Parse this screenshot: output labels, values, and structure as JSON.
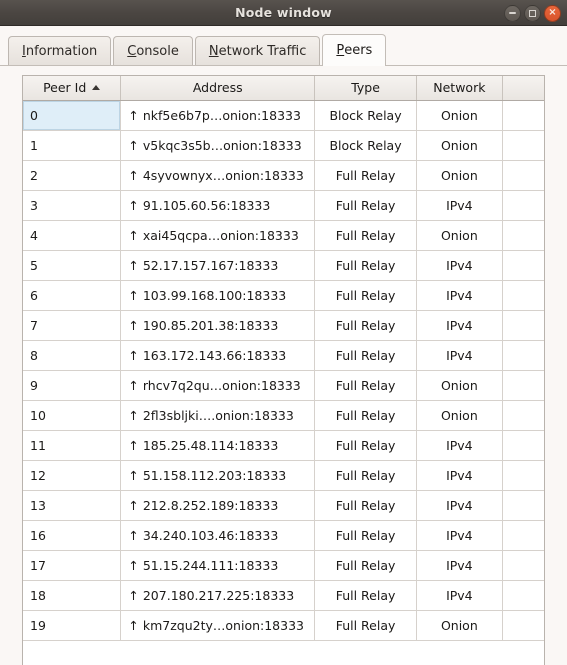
{
  "window": {
    "title": "Node window",
    "controls": [
      {
        "name": "minimize",
        "label": "–"
      },
      {
        "name": "maximize",
        "label": "□"
      },
      {
        "name": "close",
        "label": "×"
      }
    ]
  },
  "tabs": [
    {
      "label": "Information",
      "mnemonic": "I",
      "rest": "nformation",
      "active": false
    },
    {
      "label": "Console",
      "mnemonic": "C",
      "rest": "onsole",
      "active": false
    },
    {
      "label": "Network Traffic",
      "mnemonic": "N",
      "rest": "etwork Traffic",
      "active": false
    },
    {
      "label": "Peers",
      "mnemonic": "P",
      "rest": "eers",
      "active": true
    }
  ],
  "table": {
    "sort_column": "Peer Id",
    "sort_direction": "ascending",
    "columns": [
      "Peer Id",
      "Address",
      "Type",
      "Network",
      ""
    ],
    "selected_row_index": 0,
    "rows": [
      {
        "id": "0",
        "arrow": "↑",
        "address": "nkf5e6b7p…onion:18333",
        "type": "Block Relay",
        "network": "Onion"
      },
      {
        "id": "1",
        "arrow": "↑",
        "address": "v5kqc3s5b…onion:18333",
        "type": "Block Relay",
        "network": "Onion"
      },
      {
        "id": "2",
        "arrow": "↑",
        "address": "4syvownyx…onion:18333",
        "type": "Full Relay",
        "network": "Onion"
      },
      {
        "id": "3",
        "arrow": "↑",
        "address": "91.105.60.56:18333",
        "type": "Full Relay",
        "network": "IPv4"
      },
      {
        "id": "4",
        "arrow": "↑",
        "address": "xai45qcpa…onion:18333",
        "type": "Full Relay",
        "network": "Onion"
      },
      {
        "id": "5",
        "arrow": "↑",
        "address": "52.17.157.167:18333",
        "type": "Full Relay",
        "network": "IPv4"
      },
      {
        "id": "6",
        "arrow": "↑",
        "address": "103.99.168.100:18333",
        "type": "Full Relay",
        "network": "IPv4"
      },
      {
        "id": "7",
        "arrow": "↑",
        "address": "190.85.201.38:18333",
        "type": "Full Relay",
        "network": "IPv4"
      },
      {
        "id": "8",
        "arrow": "↑",
        "address": "163.172.143.66:18333",
        "type": "Full Relay",
        "network": "IPv4"
      },
      {
        "id": "9",
        "arrow": "↑",
        "address": "rhcv7q2qu…onion:18333",
        "type": "Full Relay",
        "network": "Onion"
      },
      {
        "id": "10",
        "arrow": "↑",
        "address": "2fl3sbljki….onion:18333",
        "type": "Full Relay",
        "network": "Onion"
      },
      {
        "id": "11",
        "arrow": "↑",
        "address": "185.25.48.114:18333",
        "type": "Full Relay",
        "network": "IPv4"
      },
      {
        "id": "12",
        "arrow": "↑",
        "address": "51.158.112.203:18333",
        "type": "Full Relay",
        "network": "IPv4"
      },
      {
        "id": "13",
        "arrow": "↑",
        "address": "212.8.252.189:18333",
        "type": "Full Relay",
        "network": "IPv4"
      },
      {
        "id": "16",
        "arrow": "↑",
        "address": "34.240.103.46:18333",
        "type": "Full Relay",
        "network": "IPv4"
      },
      {
        "id": "17",
        "arrow": "↑",
        "address": "51.15.244.111:18333",
        "type": "Full Relay",
        "network": "IPv4"
      },
      {
        "id": "18",
        "arrow": "↑",
        "address": "207.180.217.225:18333",
        "type": "Full Relay",
        "network": "IPv4"
      },
      {
        "id": "19",
        "arrow": "↑",
        "address": "km7zqu2ty…onion:18333",
        "type": "Full Relay",
        "network": "Onion"
      }
    ]
  },
  "colors": {
    "titlebar": "#4b4642",
    "close_button": "#d9542c",
    "selection": "#dfeef8",
    "window_background": "#faf7f5"
  }
}
